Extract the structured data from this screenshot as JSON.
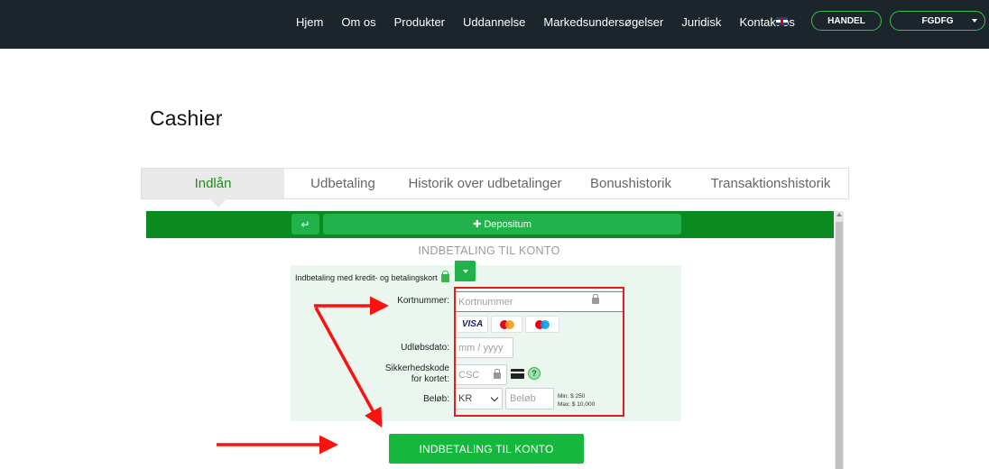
{
  "header": {
    "nav": [
      "Hjem",
      "Om os",
      "Produkter",
      "Uddannelse",
      "Markedsundersøgelser",
      "Juridisk",
      "Kontakt os"
    ],
    "flag_icon": "uk-flag-icon",
    "trade_button": "HANDEL",
    "user_menu": "FGDFG"
  },
  "page": {
    "title": "Cashier"
  },
  "tabs": [
    {
      "label": "Indlån",
      "active": true
    },
    {
      "label": "Udbetaling",
      "active": false
    },
    {
      "label": "Historik over udbetalinger",
      "active": false
    },
    {
      "label": "Bonushistorik",
      "active": false
    },
    {
      "label": "Transaktionshistorik",
      "active": false
    }
  ],
  "cashier": {
    "back_icon": "return-arrow-icon",
    "deposit_button": "Depositum",
    "section_title": "INDBETALING TIL KONTO",
    "form_heading": "Indbetaling med kredit- og betalingskort",
    "card_number_label": "Kortnummer:",
    "card_number_placeholder": "Kortnummer",
    "brands": [
      "VISA",
      "Mastercard",
      "Maestro"
    ],
    "expiry_label": "Udløbsdato:",
    "expiry_placeholder": "mm / yyyy",
    "csc_label_line1": "Sikkerhedskode",
    "csc_label_line2": "for kortet:",
    "csc_placeholder": "CSC",
    "amount_label": "Beløb:",
    "currency": "KR",
    "amount_placeholder": "Beløb",
    "min_text": "Min: $ 250",
    "max_text": "Max: $ 10,000",
    "submit_button": "INDBETALING TIL KONTO"
  },
  "colors": {
    "topbar": "#1b252b",
    "accent_green": "#22b24c",
    "dark_green": "#0b8a1f",
    "annotation_red": "#e02020"
  }
}
